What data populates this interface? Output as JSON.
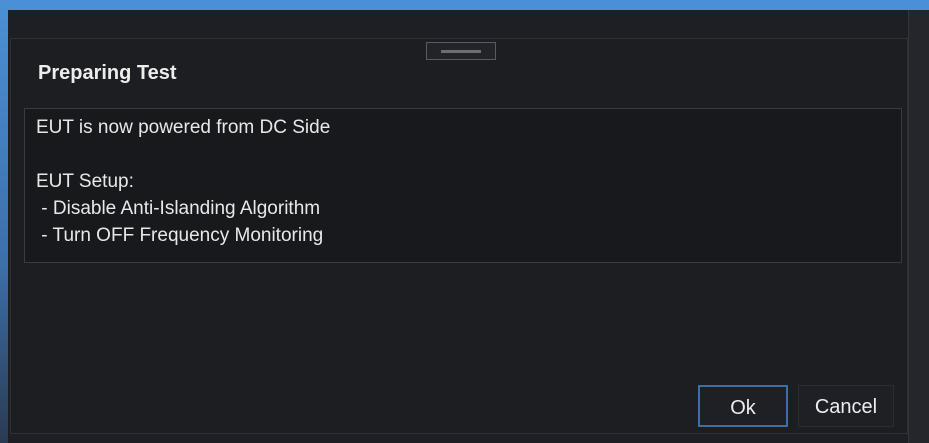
{
  "dialog": {
    "title": "Preparing Test",
    "message_lines": [
      "EUT is now powered from DC Side",
      "",
      "EUT Setup:",
      " - Disable Anti-Islanding Algorithm",
      " - Turn OFF Frequency Monitoring"
    ],
    "buttons": {
      "ok_label": "Ok",
      "cancel_label": "Cancel"
    }
  },
  "colors": {
    "accent": "#4b90d6",
    "background": "#1d1e22",
    "text": "#ededed"
  }
}
